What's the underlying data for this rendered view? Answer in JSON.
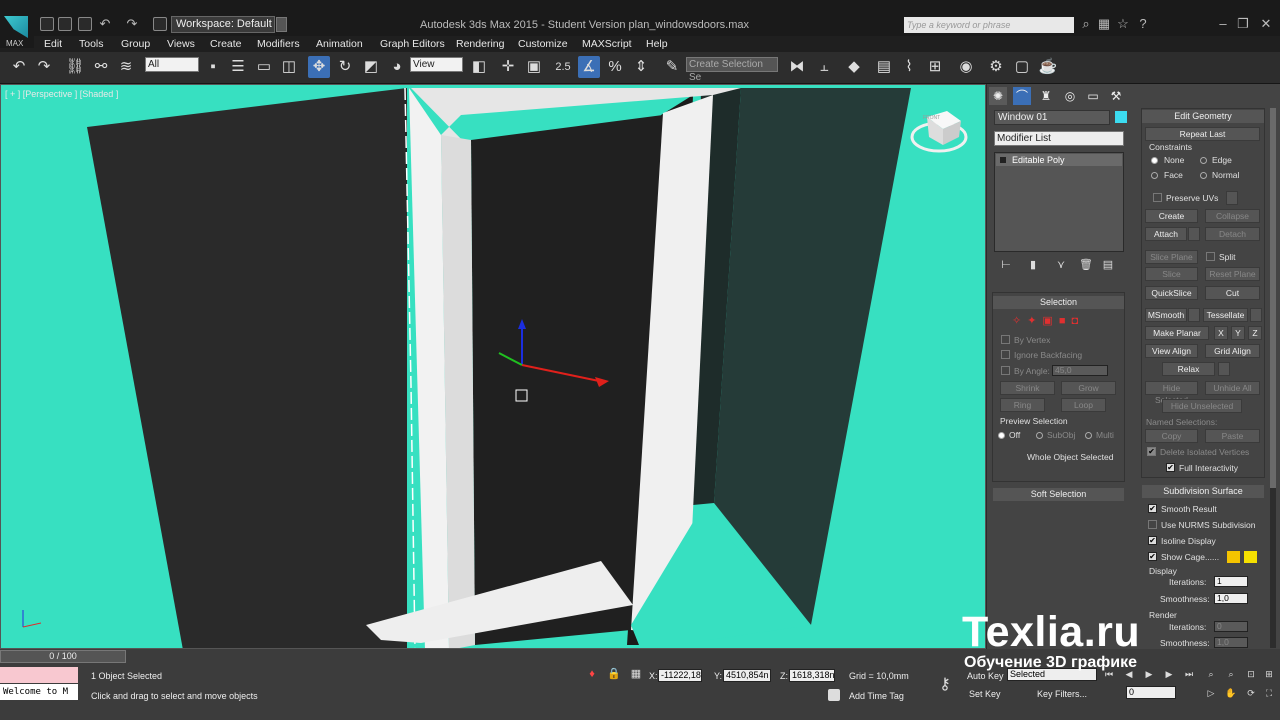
{
  "app": {
    "workspace": "Workspace: Default",
    "window_title": "Autodesk 3ds Max  2015  - Student Version    plan_windowsdoors.max",
    "search_placeholder": "Type a keyword or phrase",
    "logo_text": "MAX"
  },
  "menu": [
    "Edit",
    "Tools",
    "Group",
    "Views",
    "Create",
    "Modifiers",
    "Animation",
    "Graph Editors",
    "Rendering",
    "Customize",
    "MAXScript",
    "Help"
  ],
  "toolbar": {
    "selection_filter": "All",
    "ref_coord": "View",
    "snap_value": "2.5",
    "named_selection": "Create Selection Se"
  },
  "viewport": {
    "label": "[ + ] [Perspective ] [Shaded ]",
    "viewcube_label": "FRONT",
    "bg_color": "#37e0c1"
  },
  "command_panel": {
    "object_name": "Window 01",
    "object_color": "#3cdcf0",
    "modifier_list": "Modifier List",
    "stack": [
      "Editable Poly"
    ],
    "selection": {
      "title": "Selection",
      "by_vertex": "By Vertex",
      "ignore_backfacing": "Ignore Backfacing",
      "by_angle": "By Angle:",
      "by_angle_value": "45,0",
      "shrink": "Shrink",
      "grow": "Grow",
      "ring": "Ring",
      "loop": "Loop",
      "preview_selection": "Preview Selection",
      "preview_off": "Off",
      "preview_subobj": "SubObj",
      "preview_multi": "Multi",
      "status": "Whole Object Selected"
    },
    "soft_selection": "Soft Selection",
    "edit_geometry": {
      "title": "Edit Geometry",
      "repeat_last": "Repeat Last",
      "constraints": "Constraints",
      "none": "None",
      "edge": "Edge",
      "face": "Face",
      "normal": "Normal",
      "preserve_uvs": "Preserve UVs",
      "create": "Create",
      "collapse": "Collapse",
      "attach": "Attach",
      "detach": "Detach",
      "slice_plane": "Slice Plane",
      "split": "Split",
      "slice": "Slice",
      "reset_plane": "Reset Plane",
      "quickslice": "QuickSlice",
      "cut": "Cut",
      "msmooth": "MSmooth",
      "tessellate": "Tessellate",
      "make_planar": "Make Planar",
      "x": "X",
      "y": "Y",
      "z": "Z",
      "view_align": "View Align",
      "grid_align": "Grid Align",
      "relax": "Relax",
      "hide_selected": "Hide Selected",
      "unhide_all": "Unhide All",
      "hide_unselected": "Hide Unselected",
      "named_selections": "Named Selections:",
      "copy": "Copy",
      "paste": "Paste",
      "delete_isolated": "Delete Isolated Vertices",
      "full_interactivity": "Full Interactivity"
    },
    "subdivision": {
      "title": "Subdivision Surface",
      "smooth_result": "Smooth Result",
      "use_nurms": "Use NURMS Subdivision",
      "isoline_display": "Isoline Display",
      "show_cage": "Show Cage......",
      "cage_color_1": "#f5c400",
      "cage_color_2": "#f5e000",
      "display": "Display",
      "iterations_label": "Iterations:",
      "iterations_value": "1",
      "smoothness_label": "Smoothness:",
      "smoothness_value": "1,0",
      "render": "Render",
      "render_iterations_value": "0",
      "render_smoothness_value": "1,0"
    }
  },
  "status": {
    "time_slider": "0 / 100",
    "objects_selected": "1 Object Selected",
    "prompt": "Click and drag to select and move objects",
    "maxscript": "Welcome to M",
    "x_label": "X:",
    "x_value": "-11222,18",
    "y_label": "Y:",
    "y_value": "4510,854n",
    "z_label": "Z:",
    "z_value": "1618,318n",
    "grid": "Grid = 10,0mm",
    "add_time_tag": "Add Time Tag",
    "auto_key": "Auto Key",
    "auto_key_mode": "Selected",
    "set_key": "Set Key",
    "key_filters": "Key Filters...",
    "frame": "0"
  },
  "watermark": {
    "brand": "Texlia.ru",
    "subtitle": "Обучение 3D графике"
  }
}
